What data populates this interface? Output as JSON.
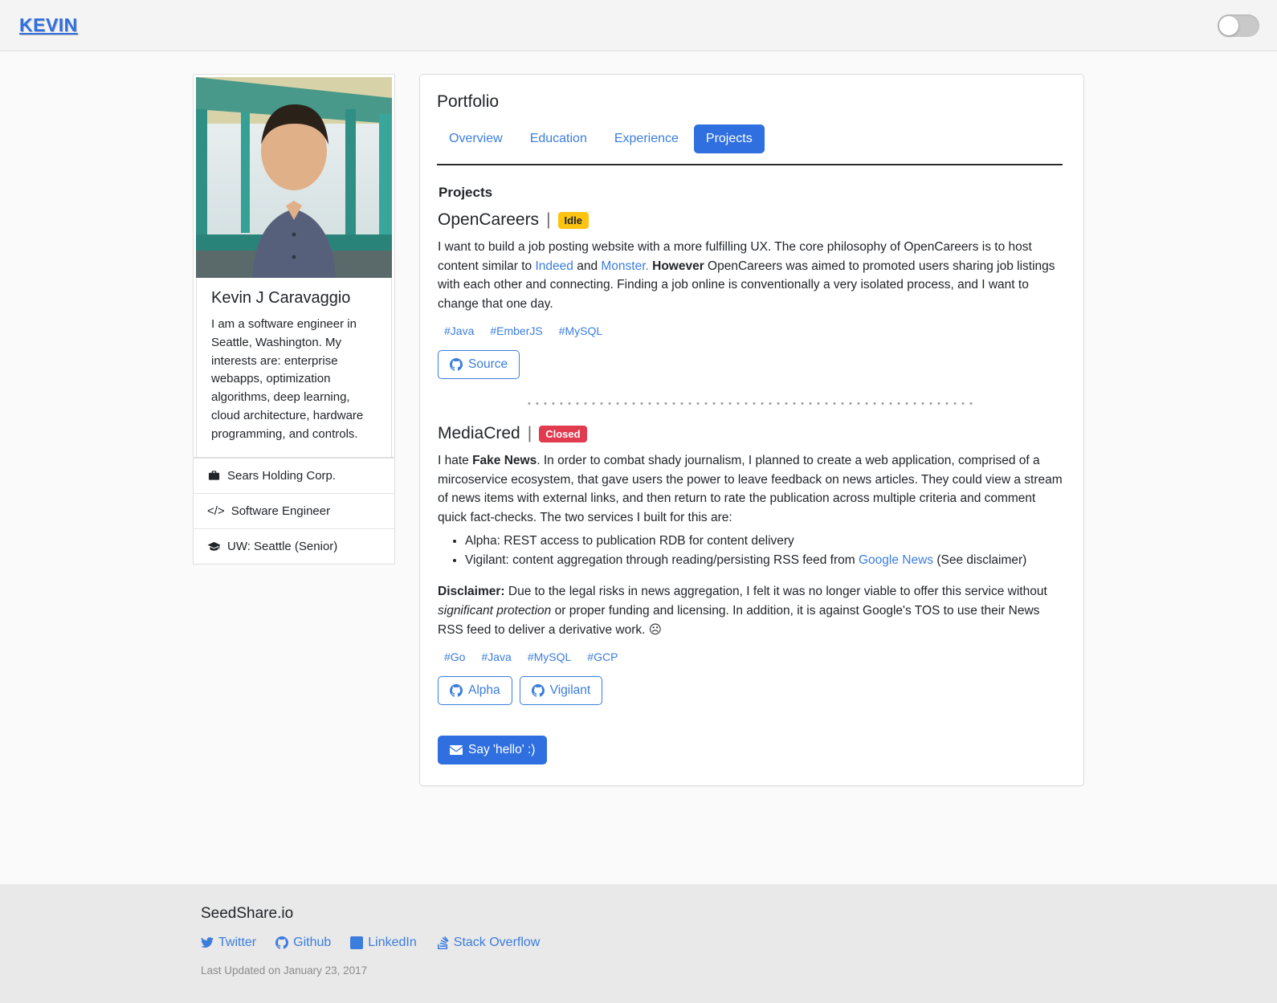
{
  "navbar": {
    "brand": "KEVIN",
    "theme_toggle_state": "off"
  },
  "sidebar": {
    "photo_alt": "portrait-photo",
    "name": "Kevin J Caravaggio",
    "bio": "I am a software engineer in Seattle, Washington. My interests are: enterprise webapps, optimization algorithms, deep learning, cloud architecture, hardware programming, and controls.",
    "info": [
      {
        "icon": "briefcase-icon",
        "label": "Sears Holding Corp."
      },
      {
        "icon": "code-icon",
        "label": "Software Engineer"
      },
      {
        "icon": "graduation-cap-icon",
        "label": "UW: Seattle (Senior)"
      }
    ]
  },
  "main": {
    "card_title": "Portfolio",
    "tabs": [
      {
        "label": "Overview",
        "active": false
      },
      {
        "label": "Education",
        "active": false
      },
      {
        "label": "Experience",
        "active": false
      },
      {
        "label": "Projects",
        "active": true
      }
    ],
    "section_heading": "Projects",
    "projects": [
      {
        "name": "OpenCareers",
        "separator": "|",
        "status": "Idle",
        "status_color": "#fcc310",
        "description_parts": {
          "p1": "I want to build a job posting website with a more fulfilling UX. The core philosophy of OpenCareers is to host content similar to ",
          "link1": "Indeed",
          "p2": " and ",
          "link2": "Monster.",
          "bold1": " However",
          "p3": " OpenCareers was aimed to promoted users sharing job listings with each other and connecting. Finding a job online is conventionally a very isolated process, and I want to change that one day."
        },
        "tags": [
          "#Java",
          "#EmberJS",
          "#MySQL"
        ],
        "buttons": [
          {
            "label": "Source",
            "icon": "github-icon"
          }
        ]
      },
      {
        "name": "MediaCred",
        "separator": "|",
        "status": "Closed",
        "status_color": "#e03b4e",
        "description_parts": {
          "p1": "I hate ",
          "bold1": "Fake News",
          "p2": ". In order to combat shady journalism, I planned to create a web application, comprised of a mircoservice ecosystem, that gave users the power to leave feedback on news articles. They could view a stream of news items with external links, and then return to rate the publication across multiple criteria and comment quick fact-checks. The two services I built for this are:"
        },
        "bullets": [
          {
            "text": "Alpha: REST access to publication RDB for content delivery"
          },
          {
            "pre": "Vigilant: content aggregation through reading/persisting RSS feed from ",
            "link": "Google News",
            "post": " (See disclaimer)"
          }
        ],
        "disclaimer": {
          "label": "Disclaimer:",
          "p1": " Due to the legal risks in news aggregation, I felt it was no longer viable to offer this service without ",
          "italic": "significant protection",
          "p2": " or proper funding and licensing. In addition, it is against Google's TOS to use their News RSS feed to deliver a derivative work. ",
          "emoji": "☹"
        },
        "tags": [
          "#Go",
          "#Java",
          "#MySQL",
          "#GCP"
        ],
        "buttons": [
          {
            "label": "Alpha",
            "icon": "github-icon"
          },
          {
            "label": "Vigilant",
            "icon": "github-icon"
          }
        ]
      }
    ],
    "contact_button": {
      "label": "Say 'hello' :)",
      "icon": "envelope-icon"
    }
  },
  "footer": {
    "title": "SeedShare.io",
    "social": [
      {
        "label": "Twitter",
        "icon": "twitter-icon"
      },
      {
        "label": "Github",
        "icon": "github-icon"
      },
      {
        "label": "LinkedIn",
        "icon": "linkedin-icon"
      },
      {
        "label": "Stack Overflow",
        "icon": "stack-overflow-icon"
      }
    ],
    "updated": "Last Updated on January 23, 2017"
  }
}
